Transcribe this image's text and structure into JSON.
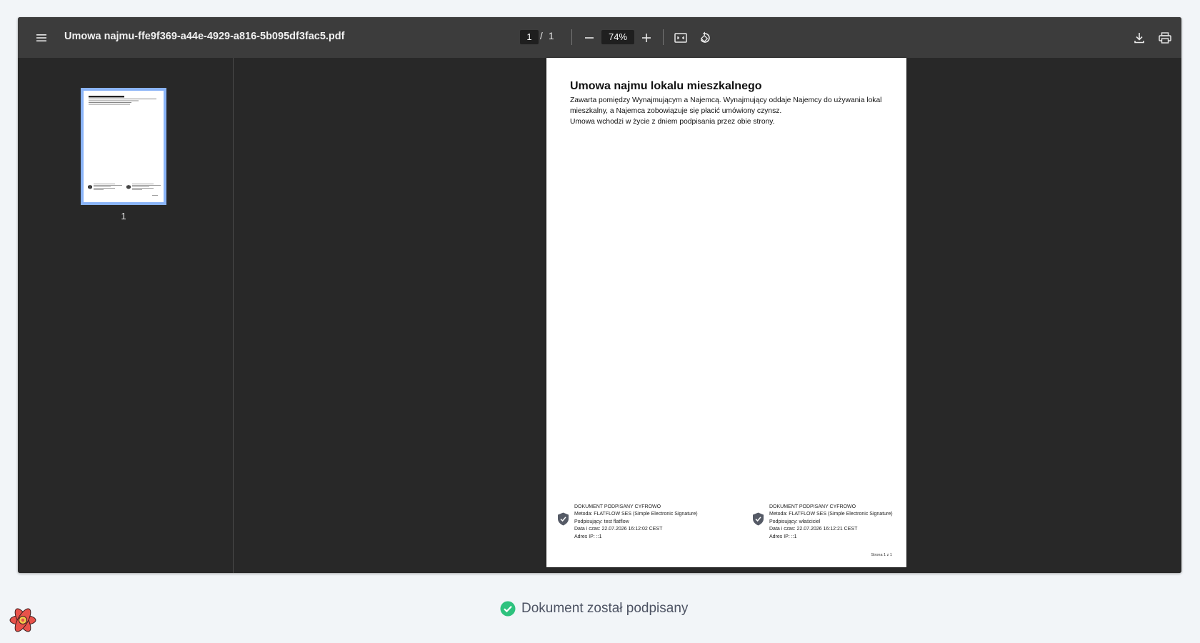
{
  "viewer": {
    "file_title": "Umowa najmu-ffe9f369-a44e-4929-a816-5b095df3fac5.pdf",
    "current_page": "1",
    "page_separator": "/",
    "total_pages": "1",
    "zoom": "74%",
    "thumbnail_label": "1"
  },
  "document": {
    "title": "Umowa najmu lokalu mieszkalnego",
    "paragraphs": [
      "Zawarta pomiędzy Wynajmującym a Najemcą. Wynajmujący oddaje Najemcy do używania lokal mieszkalny, a Najemca zobowiązuje się płacić umówiony czynsz.",
      "Umowa wchodzi w życie z dniem podpisania przez obie strony."
    ],
    "signatures": [
      {
        "heading": "DOKUMENT PODPISANY CYFROWO",
        "method": "Metoda: FLATFLOW SES (Simple Electronic Signature)",
        "signer": "Podpisujący: test flatflow",
        "datetime": "Data i czas: 22.07.2026 16:12:02 CEST",
        "ip": "Adres IP: ::1"
      },
      {
        "heading": "DOKUMENT PODPISANY CYFROWO",
        "method": "Metoda: FLATFLOW SES (Simple Electronic Signature)",
        "signer": "Podpisujący: właściciel",
        "datetime": "Data i czas: 22.07.2026 16:12:21 CEST",
        "ip": "Adres IP: ::1"
      }
    ],
    "page_footer": "Strona 1 z 1"
  },
  "status": {
    "message": "Dokument został podpisany",
    "color": "#2ec27e"
  },
  "icons": {
    "menu": "hamburger-icon",
    "zoom_out": "minus-icon",
    "zoom_in": "plus-icon",
    "fit": "fit-page-icon",
    "rotate": "rotate-icon",
    "download": "download-icon",
    "print": "print-icon",
    "signature": "shield-check-icon",
    "status": "check-circle-icon",
    "brand": "react-logo-icon"
  }
}
